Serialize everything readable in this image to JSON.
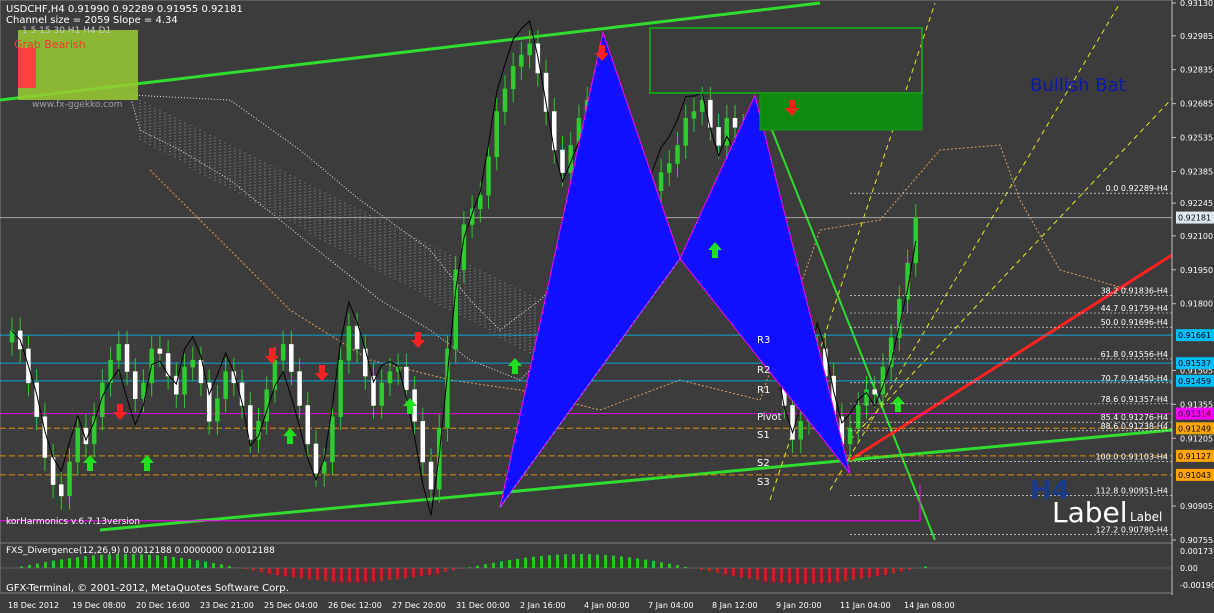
{
  "header": {
    "symbol_line": "USDCHF,H4 0.91990 0.92289 0.91955 0.92181",
    "channel_line": "Channel size = 2059 Slope = 4.34",
    "timeframes": "1  5  15  30  H1  H4  D1",
    "grab_label": "Grab Bearish",
    "site": "www.fx-ggekko.com",
    "bullish_bat": "Bullish Bat",
    "version_label": "korHarmonics v.6.7.13version",
    "copyright": "GFX-Terminal, © 2001-2012, MetaQuotes Software Corp.",
    "big_tf": "H4",
    "big_label": "Label",
    "small_label": "Label"
  },
  "pivot_labels": [
    "R3",
    "R2",
    "R1",
    "Pivot",
    "S1",
    "S2",
    "S3"
  ],
  "fib_levels": [
    {
      "text": "0.0 0.92289-H4",
      "price": 0.92289
    },
    {
      "text": "38.2 0.91836-H4",
      "price": 0.91836
    },
    {
      "text": "44.7 0.91759-H4",
      "price": 0.91759
    },
    {
      "text": "50.0 0.91696-H4",
      "price": 0.91696
    },
    {
      "text": "61.8 0.91556-H4",
      "price": 0.91556
    },
    {
      "text": "70.7 0.91450-H4",
      "price": 0.9145
    },
    {
      "text": "78.6 0.91357-H4",
      "price": 0.91357
    },
    {
      "text": "85.4 0.91276-H4",
      "price": 0.91276
    },
    {
      "text": "88.6 0.91238-H4",
      "price": 0.91238
    },
    {
      "text": "100.0 0.91103-H4",
      "price": 0.91103
    },
    {
      "text": "112.8 0.90951-H4",
      "price": 0.90951
    },
    {
      "text": "127.2 0.90780-H4",
      "price": 0.9078
    }
  ],
  "price_axis": [
    "0.93130",
    "0.92985",
    "0.92835",
    "0.92685",
    "0.92535",
    "0.92385",
    "0.92245",
    "0.92100",
    "0.91950",
    "0.91800",
    "0.91505",
    "0.91355",
    "0.91205",
    "0.90905",
    "0.90755"
  ],
  "price_tags": [
    {
      "text": "0.92181",
      "price": 0.92181,
      "color": "#dfe7ef"
    },
    {
      "text": "0.91661",
      "price": 0.91661,
      "color": "#00bfff"
    },
    {
      "text": "0.91537",
      "price": 0.91537,
      "color": "#00bfff"
    },
    {
      "text": "0.91459",
      "price": 0.91459,
      "color": "#00bfff"
    },
    {
      "text": "0.91314",
      "price": 0.91314,
      "color": "#ff00ff"
    },
    {
      "text": "0.91249",
      "price": 0.91249,
      "color": "#ffa500"
    },
    {
      "text": "0.91127",
      "price": 0.91127,
      "color": "#ffa500"
    },
    {
      "text": "0.91043",
      "price": 0.91043,
      "color": "#ffa500"
    }
  ],
  "time_axis": [
    "18 Dec 2012",
    "19 Dec 08:00",
    "20 Dec 16:00",
    "23 Dec 21:00",
    "25 Dec 04:00",
    "26 Dec 12:00",
    "27 Dec 20:00",
    "31 Dec 00:00",
    "2 Jan 16:00",
    "4 Jan 00:00",
    "7 Jan 04:00",
    "8 Jan 12:00",
    "9 Jan 20:00",
    "11 Jan 04:00",
    "14 Jan 08:00"
  ],
  "oscillator": {
    "label": "FXS_Divergence(12,26,9) 0.0012188 0.0000000 0.0012188",
    "axis": [
      "0.00173",
      "0.00",
      "-0.00190"
    ]
  },
  "zone_labels": [
    "0.92929",
    "0.92929",
    "0.92525"
  ],
  "chart_data": {
    "type": "candlestick",
    "title": "USDCHF,H4",
    "ylim": [
      0.90755,
      0.9313
    ],
    "closes": [
      0.9168,
      0.916,
      0.9145,
      0.913,
      0.9112,
      0.91,
      0.9095,
      0.911,
      0.9125,
      0.9118,
      0.913,
      0.9145,
      0.9155,
      0.9162,
      0.915,
      0.9138,
      0.9145,
      0.916,
      0.9158,
      0.9148,
      0.914,
      0.9152,
      0.9155,
      0.9145,
      0.9128,
      0.9138,
      0.915,
      0.9145,
      0.9135,
      0.912,
      0.9128,
      0.9142,
      0.9155,
      0.9162,
      0.915,
      0.9135,
      0.9118,
      0.9105,
      0.911,
      0.913,
      0.9155,
      0.917,
      0.916,
      0.9148,
      0.9135,
      0.9145,
      0.915,
      0.9152,
      0.9142,
      0.9128,
      0.911,
      0.9098,
      0.9125,
      0.916,
      0.9195,
      0.9215,
      0.9222,
      0.9228,
      0.9245,
      0.9265,
      0.9275,
      0.9285,
      0.929,
      0.9295,
      0.9282,
      0.9265,
      0.9248,
      0.9238,
      0.925,
      0.9262,
      0.927,
      0.9262,
      0.9248,
      0.9235,
      0.9218,
      0.9205,
      0.9212,
      0.922,
      0.923,
      0.9238,
      0.9242,
      0.925,
      0.9262,
      0.9265,
      0.927,
      0.9258,
      0.925,
      0.9262,
      0.9258,
      0.925,
      0.9235,
      0.921,
      0.9185,
      0.916,
      0.9135,
      0.912,
      0.9128,
      0.9145,
      0.916,
      0.9148,
      0.913,
      0.9118,
      0.9125,
      0.9135,
      0.9142,
      0.914,
      0.9152,
      0.9165,
      0.9182,
      0.9198,
      0.9218
    ],
    "pattern_points": {
      "X": 0.909,
      "A": 0.93,
      "B": 0.92,
      "C": 0.9272,
      "D": 0.9105
    }
  }
}
